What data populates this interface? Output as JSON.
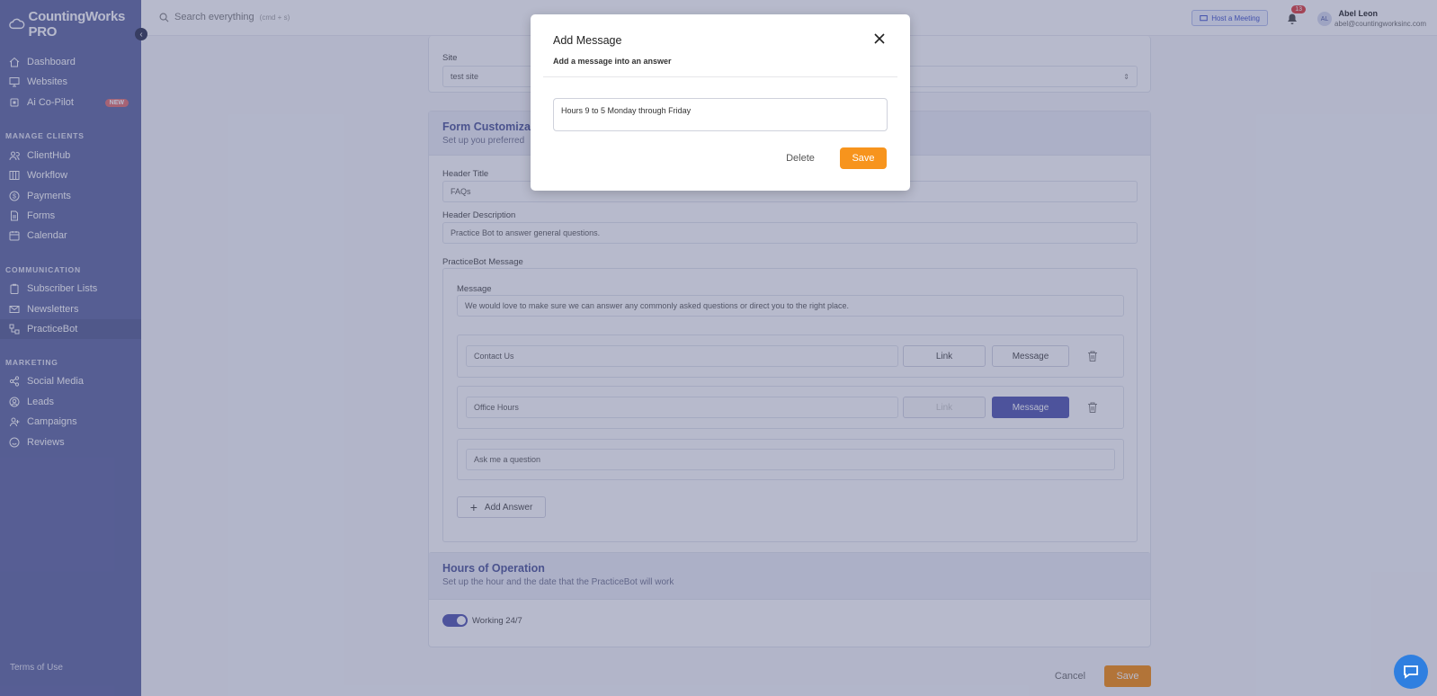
{
  "app": {
    "name": "CountingWorks PRO"
  },
  "sidebar": {
    "items": [
      {
        "label": "Dashboard",
        "icon": "home-icon"
      },
      {
        "label": "Websites",
        "icon": "monitor-icon"
      },
      {
        "label": "Ai Co-Pilot",
        "icon": "chip-icon",
        "badge": "NEW"
      }
    ],
    "sections": [
      {
        "label": "MANAGE CLIENTS",
        "items": [
          "ClientHub",
          "Workflow",
          "Payments",
          "Forms",
          "Calendar"
        ]
      },
      {
        "label": "COMMUNICATION",
        "items": [
          "Subscriber Lists",
          "Newsletters",
          "PracticeBot"
        ]
      },
      {
        "label": "MARKETING",
        "items": [
          "Social Media",
          "Leads",
          "Campaigns",
          "Reviews"
        ]
      }
    ],
    "active": "PracticeBot",
    "terms": "Terms of Use"
  },
  "topbar": {
    "search_placeholder": "Search everything",
    "search_shortcut": "(cmd + s)",
    "host_meeting": "Host a Meeting",
    "notifications": "13",
    "avatar_initials": "AL",
    "user_name": "Abel Leon",
    "user_email": "abel@countingworksinc.com"
  },
  "form": {
    "site_label": "Site",
    "site_value": "test site",
    "customization_title": "Form Customization",
    "customization_sub": "Set up you preferred",
    "header_title_label": "Header Title",
    "header_title_value": "FAQs",
    "header_desc_label": "Header Description",
    "header_desc_value": "Practice Bot to answer general questions.",
    "bot_message_label": "PracticeBot Message",
    "message_label": "Message",
    "message_value": "We would love to make sure we can answer any commonly asked questions or direct you to the right place.",
    "answers": [
      {
        "value": "Contact Us",
        "link": "Link",
        "message": "Message",
        "selected": "link"
      },
      {
        "value": "Office Hours",
        "link": "Link",
        "message": "Message",
        "selected": "message"
      }
    ],
    "ask_placeholder": "Ask me a question",
    "add_answer": "Add Answer",
    "hours_title": "Hours of Operation",
    "hours_sub": "Set up the hour and the date that the PracticeBot will work",
    "working_label": "Working 24/7",
    "cancel": "Cancel",
    "save": "Save"
  },
  "modal": {
    "title": "Add Message",
    "subtitle": "Add a message into an answer",
    "text_value": "Hours 9 to 5 Monday through Friday",
    "delete": "Delete",
    "save": "Save"
  },
  "colors": {
    "sidebar": "#6b72a8",
    "accent": "#5d62b6",
    "orange": "#f7941d"
  }
}
